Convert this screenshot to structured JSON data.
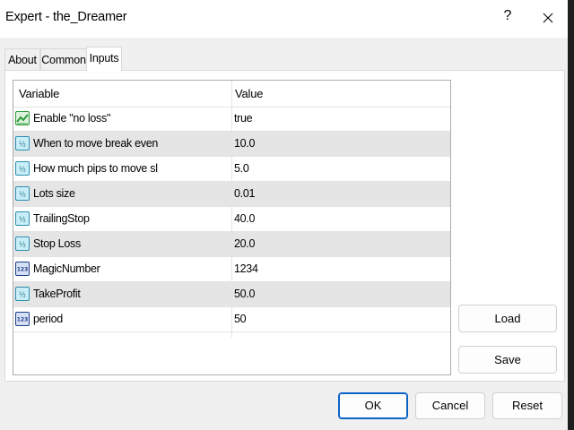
{
  "window": {
    "title": "Expert - the_Dreamer",
    "help_label": "?"
  },
  "tabs": [
    {
      "label": "About",
      "active": false
    },
    {
      "label": "Common",
      "active": false
    },
    {
      "label": "Inputs",
      "active": true
    }
  ],
  "grid": {
    "columns": [
      "Variable",
      "Value"
    ],
    "rows": [
      {
        "icon": "toggle-icon",
        "name": "Enable \"no loss\"",
        "value": "true"
      },
      {
        "icon": "double-icon",
        "name": "When to move break even",
        "value": "10.0"
      },
      {
        "icon": "double-icon",
        "name": "How much pips to move sl",
        "value": "5.0"
      },
      {
        "icon": "double-icon",
        "name": "Lots size",
        "value": "0.01"
      },
      {
        "icon": "double-icon",
        "name": "TrailingStop",
        "value": "40.0"
      },
      {
        "icon": "double-icon",
        "name": "Stop Loss",
        "value": "20.0"
      },
      {
        "icon": "integer-icon",
        "name": "MagicNumber",
        "value": "1234"
      },
      {
        "icon": "double-icon",
        "name": "TakeProfit",
        "value": "50.0"
      },
      {
        "icon": "integer-icon",
        "name": "period",
        "value": "50"
      }
    ]
  },
  "side_buttons": {
    "load": "Load",
    "save": "Save"
  },
  "footer_buttons": {
    "ok": "OK",
    "cancel": "Cancel",
    "reset": "Reset"
  },
  "colors": {
    "accent": "#0a64c8",
    "alt_row": "#e5e5e5",
    "double_icon": "#2b8fb0",
    "integer_icon": "#1f3f8c",
    "toggle_icon": "#2f9e3a"
  }
}
